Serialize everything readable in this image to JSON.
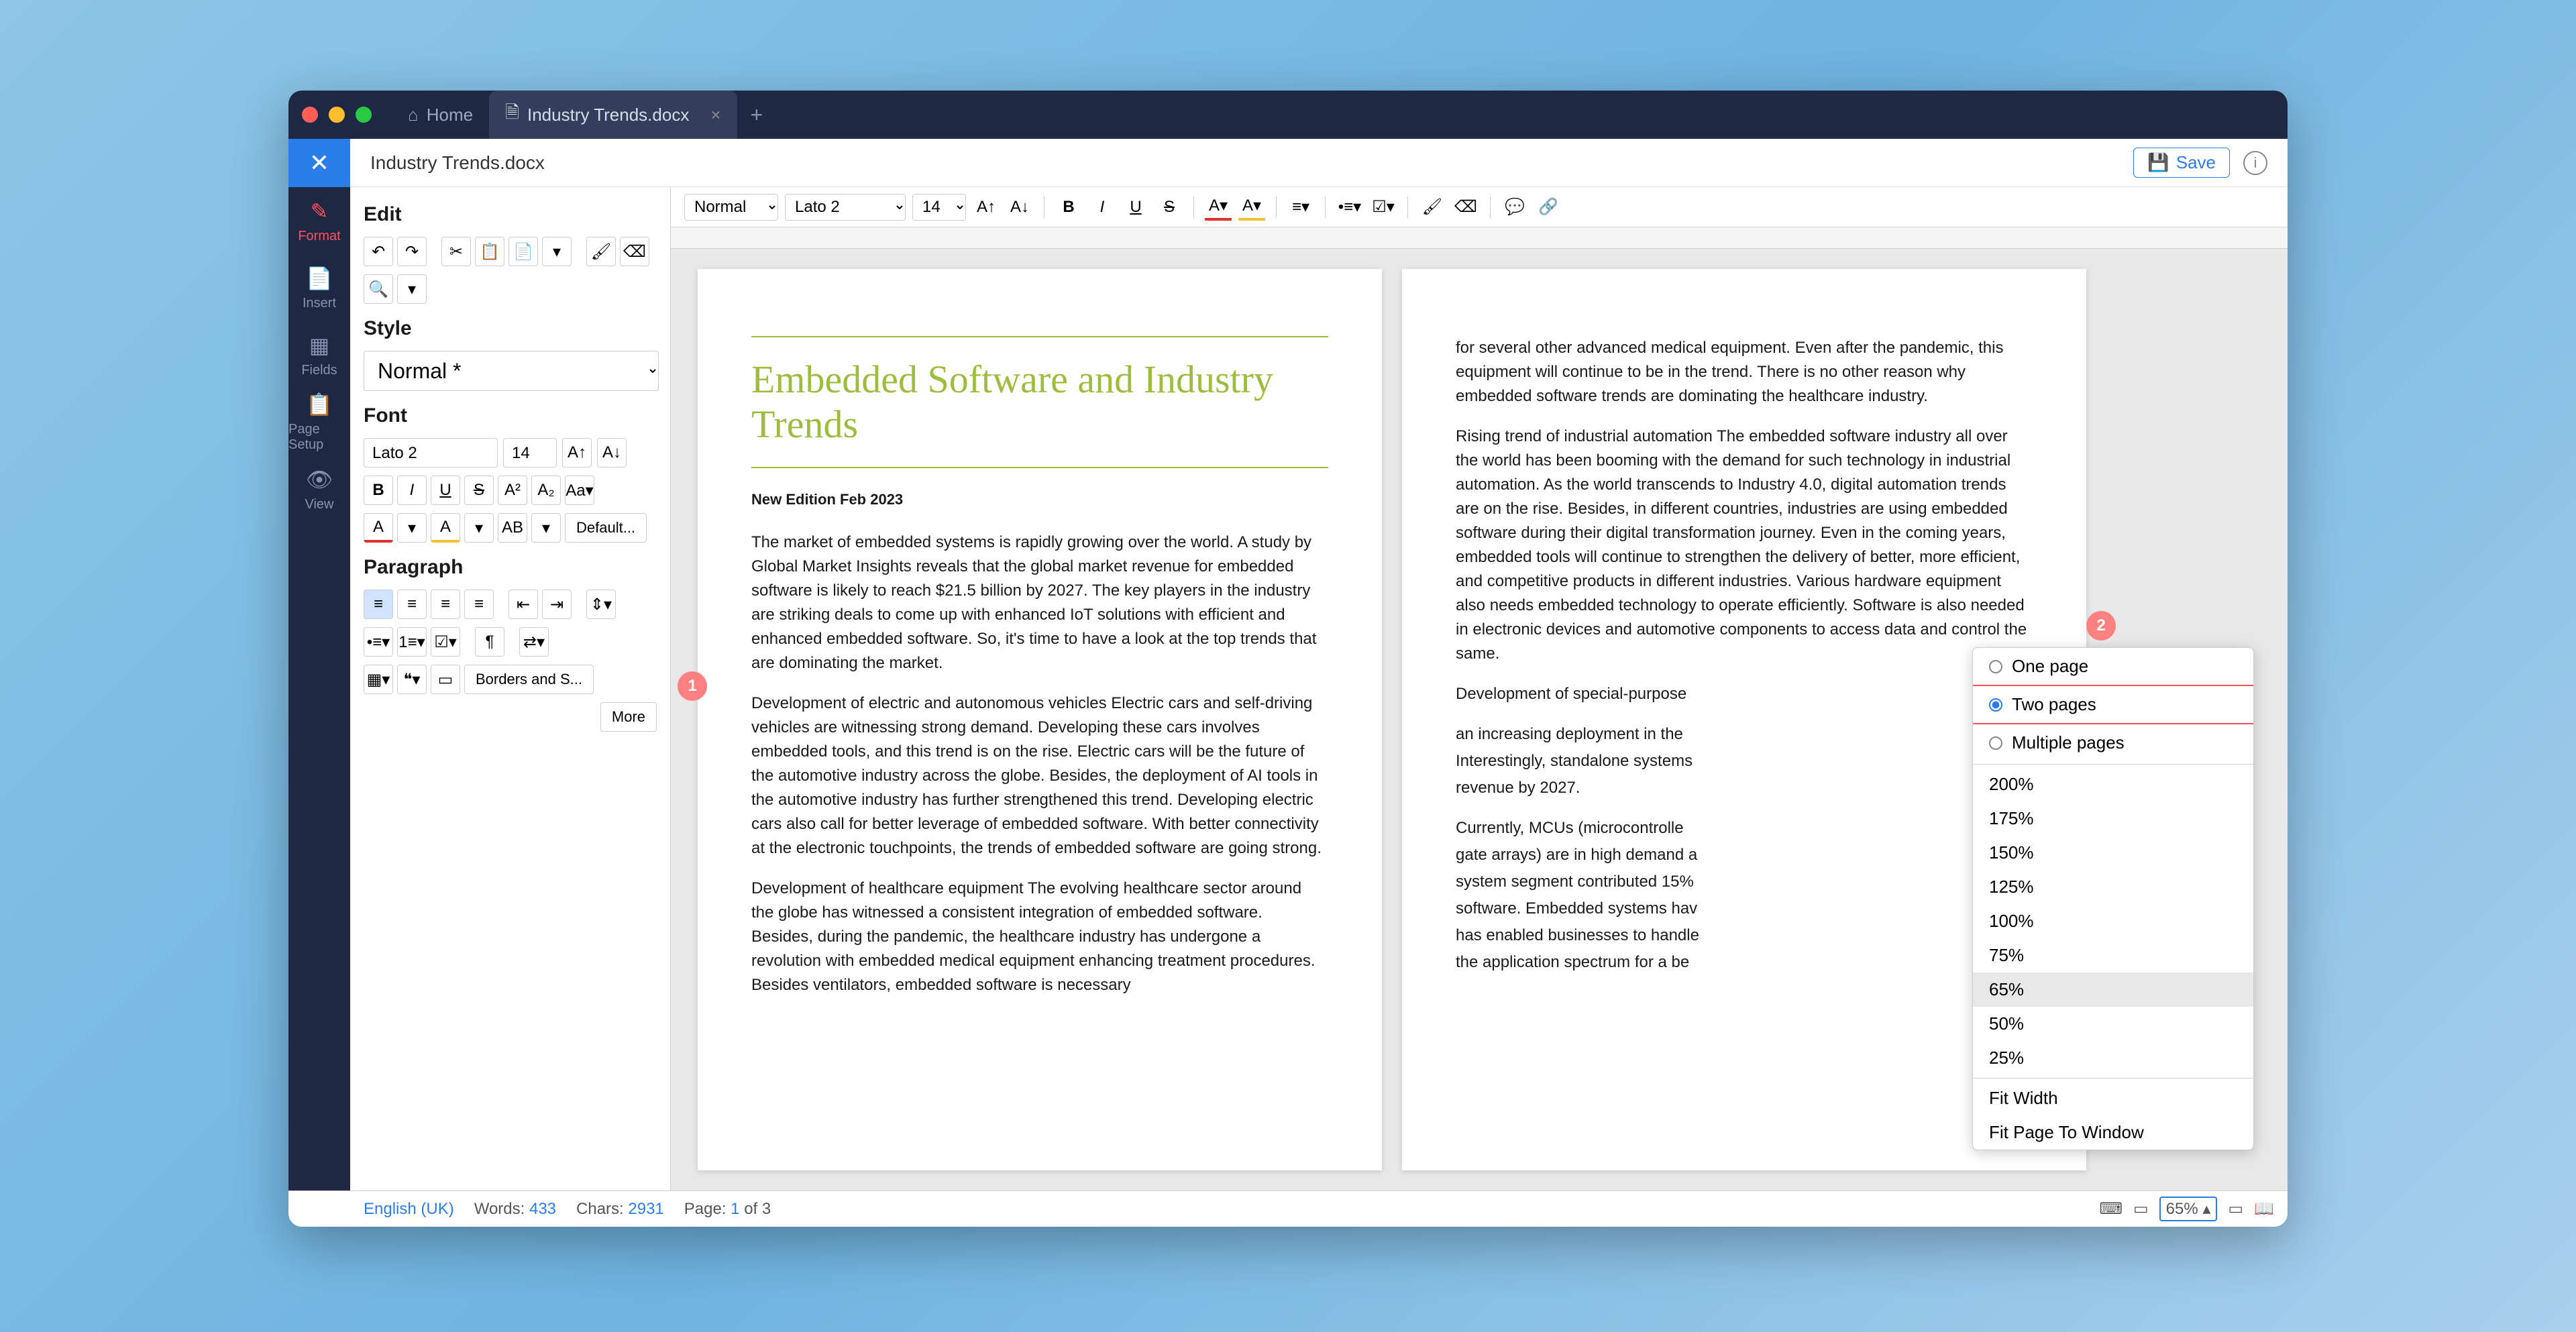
{
  "titlebar": {
    "home": "Home",
    "tab_title": "Industry Trends.docx"
  },
  "subheader": {
    "filename": "Industry Trends.docx",
    "save": "Save"
  },
  "sidebar": {
    "items": [
      "Format",
      "Insert",
      "Fields",
      "Page Setup",
      "View"
    ]
  },
  "panel": {
    "edit": "Edit",
    "style": "Style",
    "style_value": "Normal *",
    "font": "Font",
    "font_family": "Lato 2",
    "font_size": "14",
    "paragraph": "Paragraph",
    "default": "Default...",
    "borders": "Borders and S...",
    "more": "More"
  },
  "toolbar": {
    "style": "Normal",
    "font": "Lato 2",
    "size": "14"
  },
  "document": {
    "title": "Embedded Software and Industry Trends",
    "edition": "New Edition Feb 2023",
    "p1": "The market of embedded systems is rapidly growing over the world. A study by Global Market Insights reveals that the global market revenue for embedded software is likely to reach $21.5 billion by 2027. The key players in the industry are striking deals to come up with enhanced IoT solutions with efficient and enhanced embedded software. So, it's time to have a look at the top trends that are dominating the market.",
    "p2": "Development of electric and autonomous vehicles Electric cars and self-driving vehicles are witnessing strong demand. Developing these cars involves embedded tools, and this trend is on the rise. Electric cars will be the future of the automotive industry across the globe. Besides, the deployment of AI tools in the automotive industry has further strengthened this trend. Developing electric cars also call for better leverage of embedded software. With better connectivity at the electronic touchpoints, the trends of embedded software are going strong.",
    "p3": "Development of healthcare equipment The evolving healthcare sector around the globe has witnessed a consistent integration of embedded software. Besides, during the pandemic, the healthcare industry has undergone a revolution with embedded medical equipment enhancing treatment procedures. Besides ventilators, embedded software is necessary",
    "p4": "for several other advanced medical equipment. Even after the pandemic, this equipment will continue to be in the trend. There is no other reason why embedded software trends are dominating the healthcare industry.",
    "p5": "Rising trend of industrial automation The embedded software industry all over the world has been booming with the demand for such technology in industrial automation. As the world transcends to Industry 4.0, digital automation trends are on the rise. Besides, in different countries, industries are using embedded software during their digital transformation journey. Even in the coming years, embedded tools will continue to strengthen the delivery of better, more efficient, and competitive products in different industries. Various hardware equipment also needs embedded technology to operate efficiently. Software is also needed in electronic devices and automotive components to access data and control the same.",
    "p6": "Development of special-purpose",
    "p7": "an increasing deployment in the",
    "p8": "Interestingly, standalone systems",
    "p9": "revenue by 2027.",
    "p10": "Currently, MCUs (microcontrolle",
    "p11": "gate arrays) are in high demand a",
    "p12": "system segment contributed 15%",
    "p13": "software. Embedded systems hav",
    "p14": "has enabled businesses to handle",
    "p15": "the application spectrum for a be"
  },
  "zoom_popup": {
    "radios": [
      "One page",
      "Two pages",
      "Multiple pages"
    ],
    "levels": [
      "200%",
      "175%",
      "150%",
      "125%",
      "100%",
      "75%",
      "65%",
      "50%",
      "25%"
    ],
    "fit_width": "Fit Width",
    "fit_window": "Fit Page To Window"
  },
  "statusbar": {
    "lang": "English (UK)",
    "words_label": "Words:",
    "words": "433",
    "chars_label": "Chars:",
    "chars": "2931",
    "page_label": "Page:",
    "page": "1",
    "page_of": "of 3",
    "zoom": "65%"
  }
}
